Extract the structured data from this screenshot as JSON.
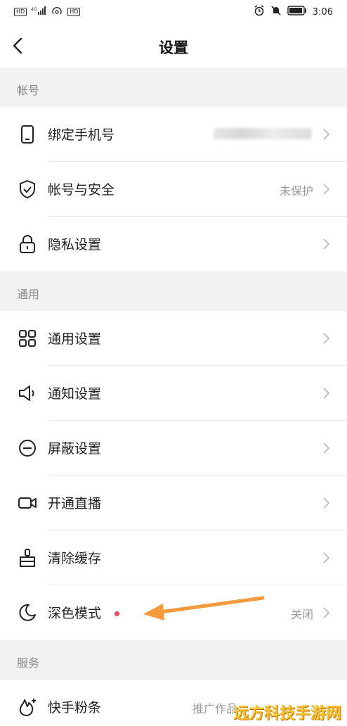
{
  "status_bar": {
    "left_badges": [
      "HD",
      "4G",
      "HD"
    ],
    "time": "3:06"
  },
  "navbar": {
    "title": "设置"
  },
  "sections": [
    {
      "header": "帐号",
      "items": [
        {
          "label": "绑定手机号",
          "value": "",
          "icon": "phone-icon"
        },
        {
          "label": "帐号与安全",
          "value": "未保护",
          "icon": "shield-icon"
        },
        {
          "label": "隐私设置",
          "value": "",
          "icon": "lock-icon"
        }
      ]
    },
    {
      "header": "通用",
      "items": [
        {
          "label": "通用设置",
          "value": "",
          "icon": "grid-icon"
        },
        {
          "label": "通知设置",
          "value": "",
          "icon": "speaker-icon"
        },
        {
          "label": "屏蔽设置",
          "value": "",
          "icon": "block-icon"
        },
        {
          "label": "开通直播",
          "value": "",
          "icon": "video-camera-icon"
        },
        {
          "label": "清除缓存",
          "value": "",
          "icon": "broom-icon"
        },
        {
          "label": "深色模式",
          "value": "关闭",
          "icon": "moon-icon"
        }
      ]
    },
    {
      "header": "服务",
      "items": [
        {
          "label": "快手粉条",
          "value": "推广作品，",
          "icon": "flame-plus-icon"
        }
      ]
    }
  ],
  "watermark": "远方科技手游网",
  "colors": {
    "background": "#f2f2f2",
    "accent_dot": "#f0475e",
    "arrow": "#f39a3d"
  }
}
